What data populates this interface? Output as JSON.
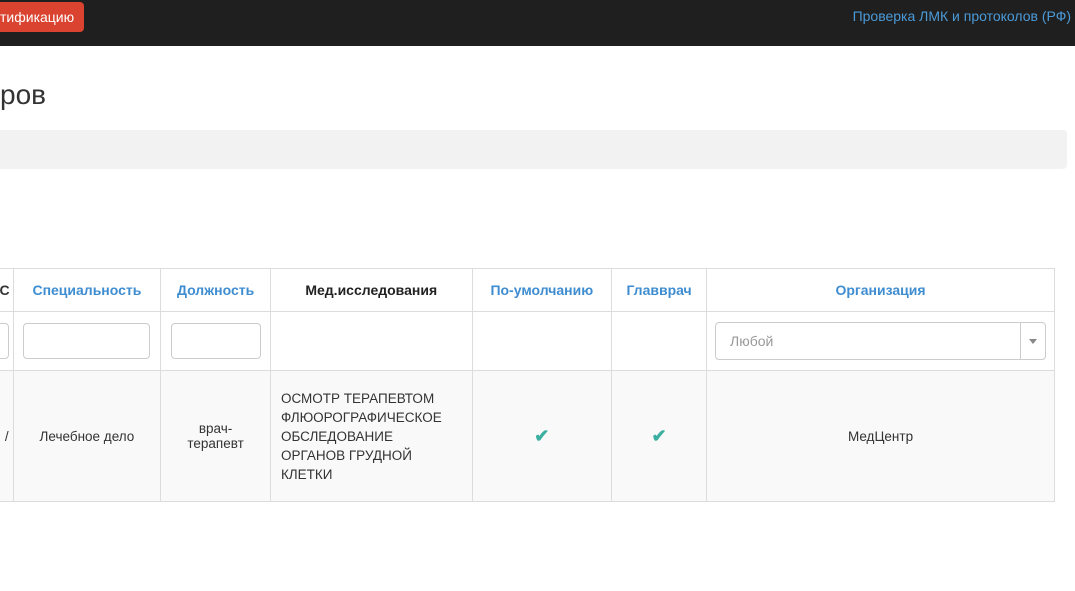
{
  "topbar": {
    "left_button": "тификацию",
    "right_link": "Проверка ЛМК и протоколов (РФ)"
  },
  "page": {
    "title": "ров"
  },
  "table": {
    "headers": {
      "col0": "С",
      "specialty": "Специальность",
      "position": "Должность",
      "research": "Мед.исследования",
      "default": "По-умолчанию",
      "chief": "Главврач",
      "organization": "Организация"
    },
    "filters": {
      "organization_placeholder": "Любой"
    },
    "rows": [
      {
        "col0": "/",
        "specialty": "Лечебное дело",
        "position_line1": "врач-",
        "position_line2": "терапевт",
        "research_lines": [
          "ОСМОТР ТЕРАПЕВТОМ",
          "ФЛЮОРОГРАФИЧЕСКОЕ",
          "ОБСЛЕДОВАНИЕ",
          "ОРГАНОВ ГРУДНОЙ",
          "КЛЕТКИ"
        ],
        "default_check": "✔",
        "chief_check": "✔",
        "organization": "МедЦентр"
      }
    ]
  },
  "colors": {
    "topbar": "#1f1f1f",
    "accent_button": "#d9432f",
    "link": "#3f8dd1",
    "check": "#3bb0a0"
  }
}
